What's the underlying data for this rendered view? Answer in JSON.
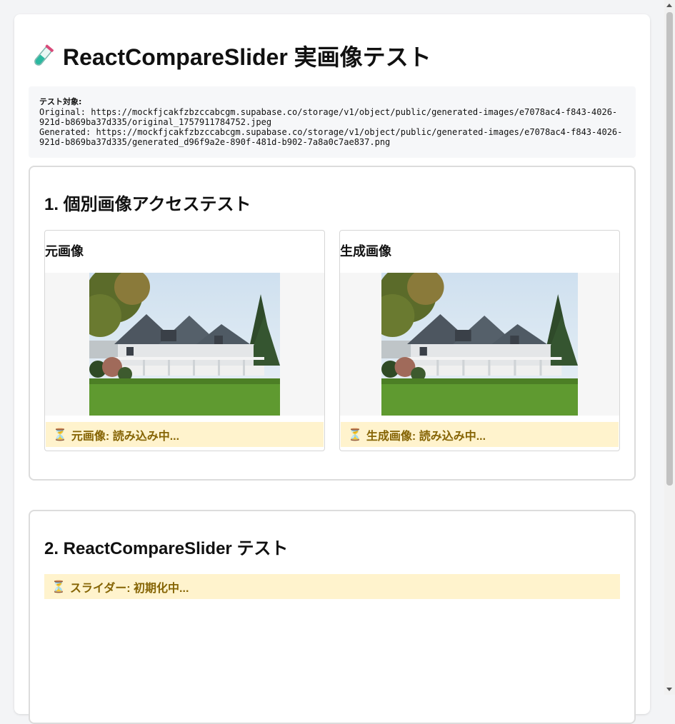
{
  "page": {
    "title": "ReactCompareSlider 実画像テスト",
    "title_icon": "test-tube-icon"
  },
  "info": {
    "label": "テスト対象:",
    "original_line1": "Original: https://mockfjcakfzbzccabcgm.supabase.co/storage/v1/object/public/generated-images/e7078ac4-f843-4026-",
    "original_line2": "921d-b869ba37d335/original_1757911784752.jpeg",
    "generated_line1": "Generated: https://mockfjcakfzbzccabcgm.supabase.co/storage/v1/object/public/generated-images/e7078ac4-f843-4026-",
    "generated_line2": "921d-b869ba37d335/generated_d96f9a2e-890f-481d-b902-7a8a0c7ae837.png"
  },
  "section1": {
    "title": "1. 個別画像アクセステスト",
    "original_card": {
      "title": "元画像",
      "status": "元画像: 読み込み中...",
      "status_icon": "hourglass-icon"
    },
    "generated_card": {
      "title": "生成画像",
      "status": "生成画像: 読み込み中...",
      "status_icon": "hourglass-icon"
    }
  },
  "section2": {
    "title": "2. ReactCompareSlider テスト",
    "status": "スライダー: 初期化中...",
    "status_icon": "hourglass-icon"
  },
  "colors": {
    "status_bg": "#fff3cd",
    "status_text": "#856404",
    "info_bg": "#f6f7f9"
  }
}
